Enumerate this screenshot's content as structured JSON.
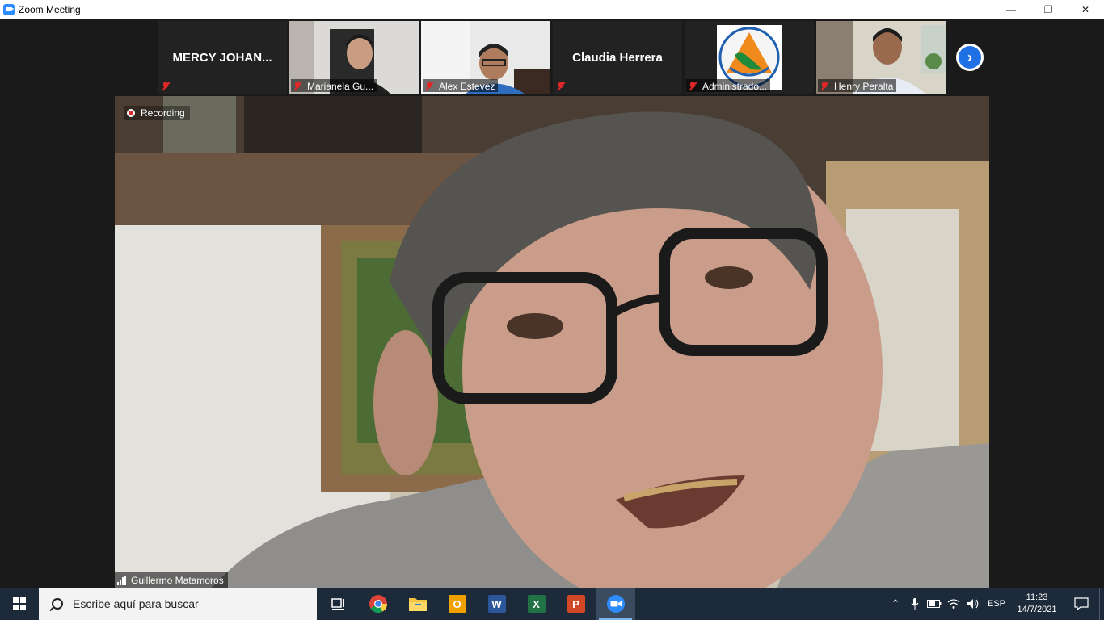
{
  "window": {
    "title": "Zoom Meeting",
    "controls": {
      "minimize": "—",
      "restore": "❐",
      "close": "✕"
    }
  },
  "thumbnails": [
    {
      "name": "MERCY  JOHAN...",
      "label": "",
      "muted": true,
      "video": false
    },
    {
      "name": "",
      "label": "Marianela Gu...",
      "muted": true,
      "video": true
    },
    {
      "name": "",
      "label": "Alex Estevez",
      "muted": true,
      "video": true
    },
    {
      "name": "Claudia Herrera",
      "label": "",
      "muted": true,
      "video": false
    },
    {
      "name": "",
      "label": "Administrado...",
      "muted": true,
      "video": true
    },
    {
      "name": "",
      "label": "Henry Peralta",
      "muted": true,
      "video": true
    }
  ],
  "next_page_icon": "chevron-right-icon",
  "main": {
    "recording_label": "Recording",
    "speaker_name": "Guillermo Matamoros"
  },
  "taskbar": {
    "search_placeholder": "Escribe aquí para buscar",
    "apps": [
      {
        "icon": "task-view-icon",
        "text": ""
      },
      {
        "icon": "chrome-icon",
        "text": ""
      },
      {
        "icon": "file-explorer-icon",
        "text": ""
      },
      {
        "icon": "outlook-icon",
        "text": "O"
      },
      {
        "icon": "word-icon",
        "text": "W"
      },
      {
        "icon": "excel-icon",
        "text": "X"
      },
      {
        "icon": "powerpoint-icon",
        "text": "P"
      },
      {
        "icon": "zoom-icon",
        "text": ""
      }
    ],
    "language": "ESP",
    "time": "11:23",
    "date": "14/7/2021"
  },
  "colors": {
    "zoom_blue": "#2d8cff",
    "mute_red": "#e02828",
    "taskbar": "#1c2a3a"
  }
}
